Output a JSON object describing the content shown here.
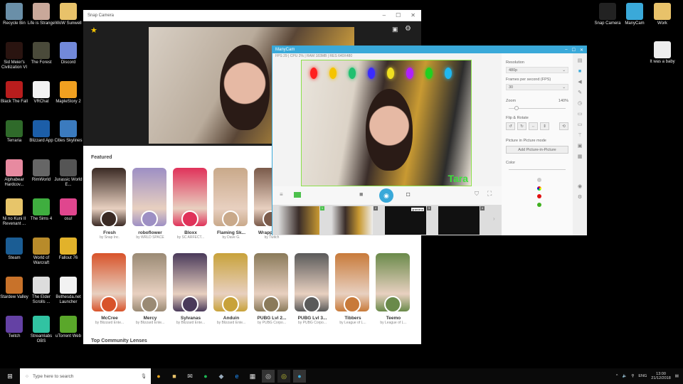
{
  "desktop_icons": [
    {
      "label": "Recycle Bin",
      "color": "#6a8fa8"
    },
    {
      "label": "Life is Strange",
      "color": "#c9a89a"
    },
    {
      "label": "WoW Sunwell",
      "color": "#e8c26a"
    },
    {
      "label": "Sid Meier's Civilization VI",
      "color": "#2a1410"
    },
    {
      "label": "The Forest",
      "color": "#4a4a3a"
    },
    {
      "label": "Discord",
      "color": "#7289da"
    },
    {
      "label": "Black The Fall",
      "color": "#b81d1d"
    },
    {
      "label": "VRChat",
      "color": "#f2f2f2"
    },
    {
      "label": "MapleStory 2",
      "color": "#f0a020"
    },
    {
      "label": "Terraria",
      "color": "#2f6a2a"
    },
    {
      "label": "Blizzard App",
      "color": "#1c5ea8"
    },
    {
      "label": "Cities Skylines",
      "color": "#3b7bbf"
    },
    {
      "label": "Alphabear Hardcov...",
      "color": "#e78aa0"
    },
    {
      "label": "RimWorld",
      "color": "#666"
    },
    {
      "label": "Jurassic World E...",
      "color": "#555"
    },
    {
      "label": "Ni no Kuni II Revenant ...",
      "color": "#e7c56a"
    },
    {
      "label": "The Sims 4",
      "color": "#3fae3f"
    },
    {
      "label": "osu!",
      "color": "#e0468e"
    },
    {
      "label": "Steam",
      "color": "#1b5d94"
    },
    {
      "label": "World of Warcraft",
      "color": "#b88b2a"
    },
    {
      "label": "Fallout 76",
      "color": "#e2b22a"
    },
    {
      "label": "Stardew Valley",
      "color": "#c8722a"
    },
    {
      "label": "The Elder Scrolls ...",
      "color": "#ddd"
    },
    {
      "label": "Bethesda.net Launcher",
      "color": "#f2f2f2"
    },
    {
      "label": "Twitch",
      "color": "#6441a4"
    },
    {
      "label": "Streamlabs OBS",
      "color": "#31c3a2"
    },
    {
      "label": "uTorrent Web",
      "color": "#5aa72a"
    }
  ],
  "right_icons": [
    {
      "label": "Snap Camera",
      "color": "#222"
    },
    {
      "label": "ManyCam",
      "color": "#3aa9d9"
    },
    {
      "label": "Work",
      "color": "#e8c26a"
    },
    {
      "label": "It was a baby",
      "color": "#eee"
    }
  ],
  "snap": {
    "title": "Snap Camera",
    "featured": "Featured",
    "top_community": "Top Community Lenses",
    "row1": [
      {
        "name": "Fresh",
        "by": "by Snap Inc.",
        "c": "#3a2a24"
      },
      {
        "name": "roboflower",
        "by": "by WRLD SPACE",
        "c": "#9d8fc4"
      },
      {
        "name": "Bloxx",
        "by": "by SC ARFECT...",
        "c": "#e0325a"
      },
      {
        "name": "Flaming Sk...",
        "by": "by Dave G.",
        "c": "#c9a98a"
      },
      {
        "name": "Wrapped Up",
        "by": "by Twitch",
        "c": "#7a5a4a"
      }
    ],
    "row2": [
      {
        "name": "McCree",
        "by": "by Blizzard Ente...",
        "c": "#d8532a"
      },
      {
        "name": "Mercy",
        "by": "by Blizzard Ente...",
        "c": "#9a8a74"
      },
      {
        "name": "Sylvanas",
        "by": "by Blizzard Ente...",
        "c": "#4a3a5a"
      },
      {
        "name": "Anduin",
        "by": "by Blizzard Ente...",
        "c": "#c8a23a"
      },
      {
        "name": "PUBG Lvl 2...",
        "by": "by PUBG Corpo...",
        "c": "#8a7a5a"
      },
      {
        "name": "PUBG Lvl 3...",
        "by": "by PUBG Corpo...",
        "c": "#5a5a5a"
      },
      {
        "name": "Tibbers",
        "by": "by League of L...",
        "c": "#c87a3a"
      },
      {
        "name": "Teemo",
        "by": "by League of L...",
        "c": "#6a8a4a"
      }
    ]
  },
  "manycam": {
    "title": "ManyCam",
    "status": "FPS 29 | CPU 2% | RAM 183MB | RES 640X480",
    "overlay_name": "Tara",
    "resolution_label": "Resolution",
    "resolution": "480p",
    "fps_label": "Frames per second (FPS)",
    "fps": "30",
    "zoom_label": "Zoom",
    "zoom_value": "140%",
    "zoom_fraction": 0.1,
    "flip_label": "Flip & Rotate",
    "pip_label": "Picture in Picture mode",
    "pip_button": "Add Picture-in-Picture",
    "color_label": "Color",
    "thumb_numbers": [
      "1",
      "2",
      "3",
      "4"
    ],
    "thumb3_caption": "grandma",
    "bulb_colors": [
      "#ff2020",
      "#f5c400",
      "#1fc070",
      "#3a2bff",
      "#f0e020",
      "#b020ff",
      "#20d020",
      "#20b8f0"
    ]
  },
  "taskbar": {
    "search_placeholder": "Type here to search",
    "time": "13:00",
    "date": "21/12/2018",
    "lang": "ENG"
  }
}
